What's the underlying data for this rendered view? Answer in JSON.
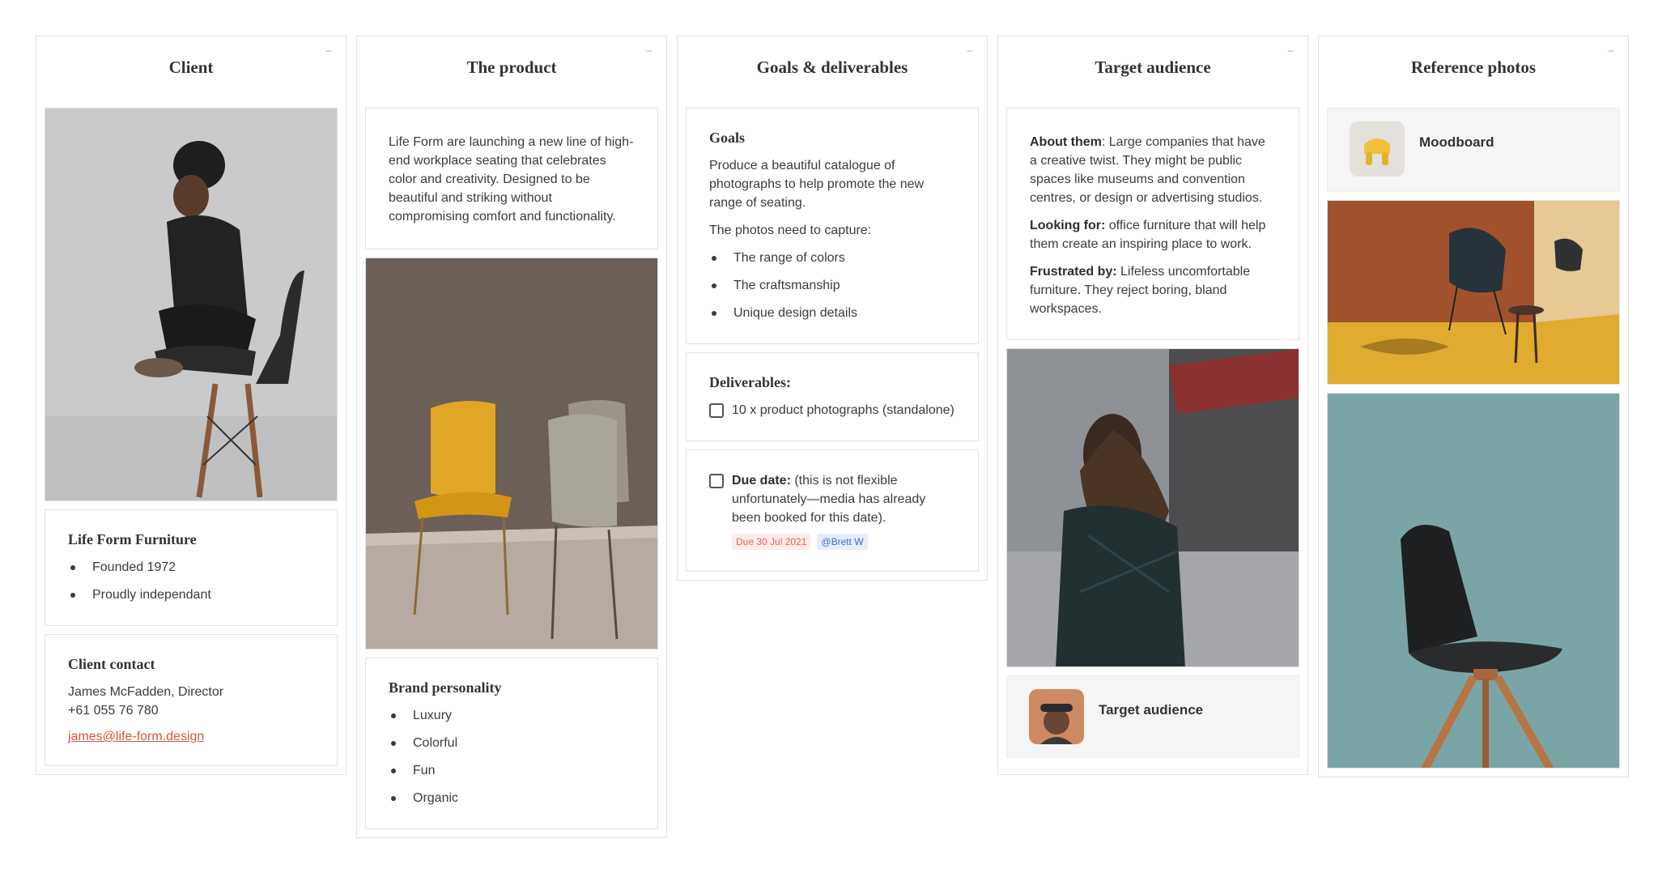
{
  "columns": {
    "client": {
      "title": "Client",
      "company_card": {
        "title": "Life Form Furniture",
        "items": [
          "Founded 1972",
          "Proudly independant"
        ]
      },
      "contact_card": {
        "title": "Client contact",
        "name_line": "James McFadden, Director",
        "phone": "+61 055 76 780",
        "email": "james@life-form.design"
      }
    },
    "product": {
      "title": "The product",
      "description": "Life Form are launching a new line of high-end workplace seating that celebrates color and creativity. Designed to be beautiful and striking without compromising comfort and functionality.",
      "brand_card": {
        "title": "Brand personality",
        "items": [
          "Luxury",
          "Colorful",
          "Fun",
          "Organic"
        ]
      }
    },
    "goals": {
      "title": "Goals & deliverables",
      "goals_card": {
        "title": "Goals",
        "text": "Produce a beautiful catalogue of photographs to help promote the new range of seating.",
        "capture_intro": "The photos need to capture:",
        "items": [
          "The range of colors",
          "The craftsmanship",
          "Unique design details"
        ]
      },
      "deliverables_card": {
        "title": "Deliverables:",
        "task": "10 x product photographs (standalone)"
      },
      "due_card": {
        "bold": "Due date:",
        "text": " (this is not flexible unfortunately—media has already been booked for this date).",
        "due_tag": "Due 30 Jul 2021",
        "mention_tag": "@Brett W"
      }
    },
    "audience": {
      "title": "Target audience",
      "about_bold": "About them",
      "about_text": ": Large companies that have a creative twist. They might be public spaces like museums and convention centres, or design or advertising studios.",
      "looking_bold": "Looking for:",
      "looking_text": " office furniture that will help them create an inspiring place to work.",
      "frustrated_bold": "Frustrated by:",
      "frustrated_text": " Lifeless uncomfortable furniture. They reject boring, bland workspaces.",
      "link_label": "Target audience"
    },
    "reference": {
      "title": "Reference photos",
      "link_label": "Moodboard"
    }
  },
  "icons": {
    "collapse": "minus-icon",
    "checkbox": "checkbox-icon"
  },
  "colors": {
    "link": "#d4583a",
    "due_tag": "#e0674e",
    "mention_tag": "#3a6bd1",
    "border": "#e2e2e2"
  }
}
